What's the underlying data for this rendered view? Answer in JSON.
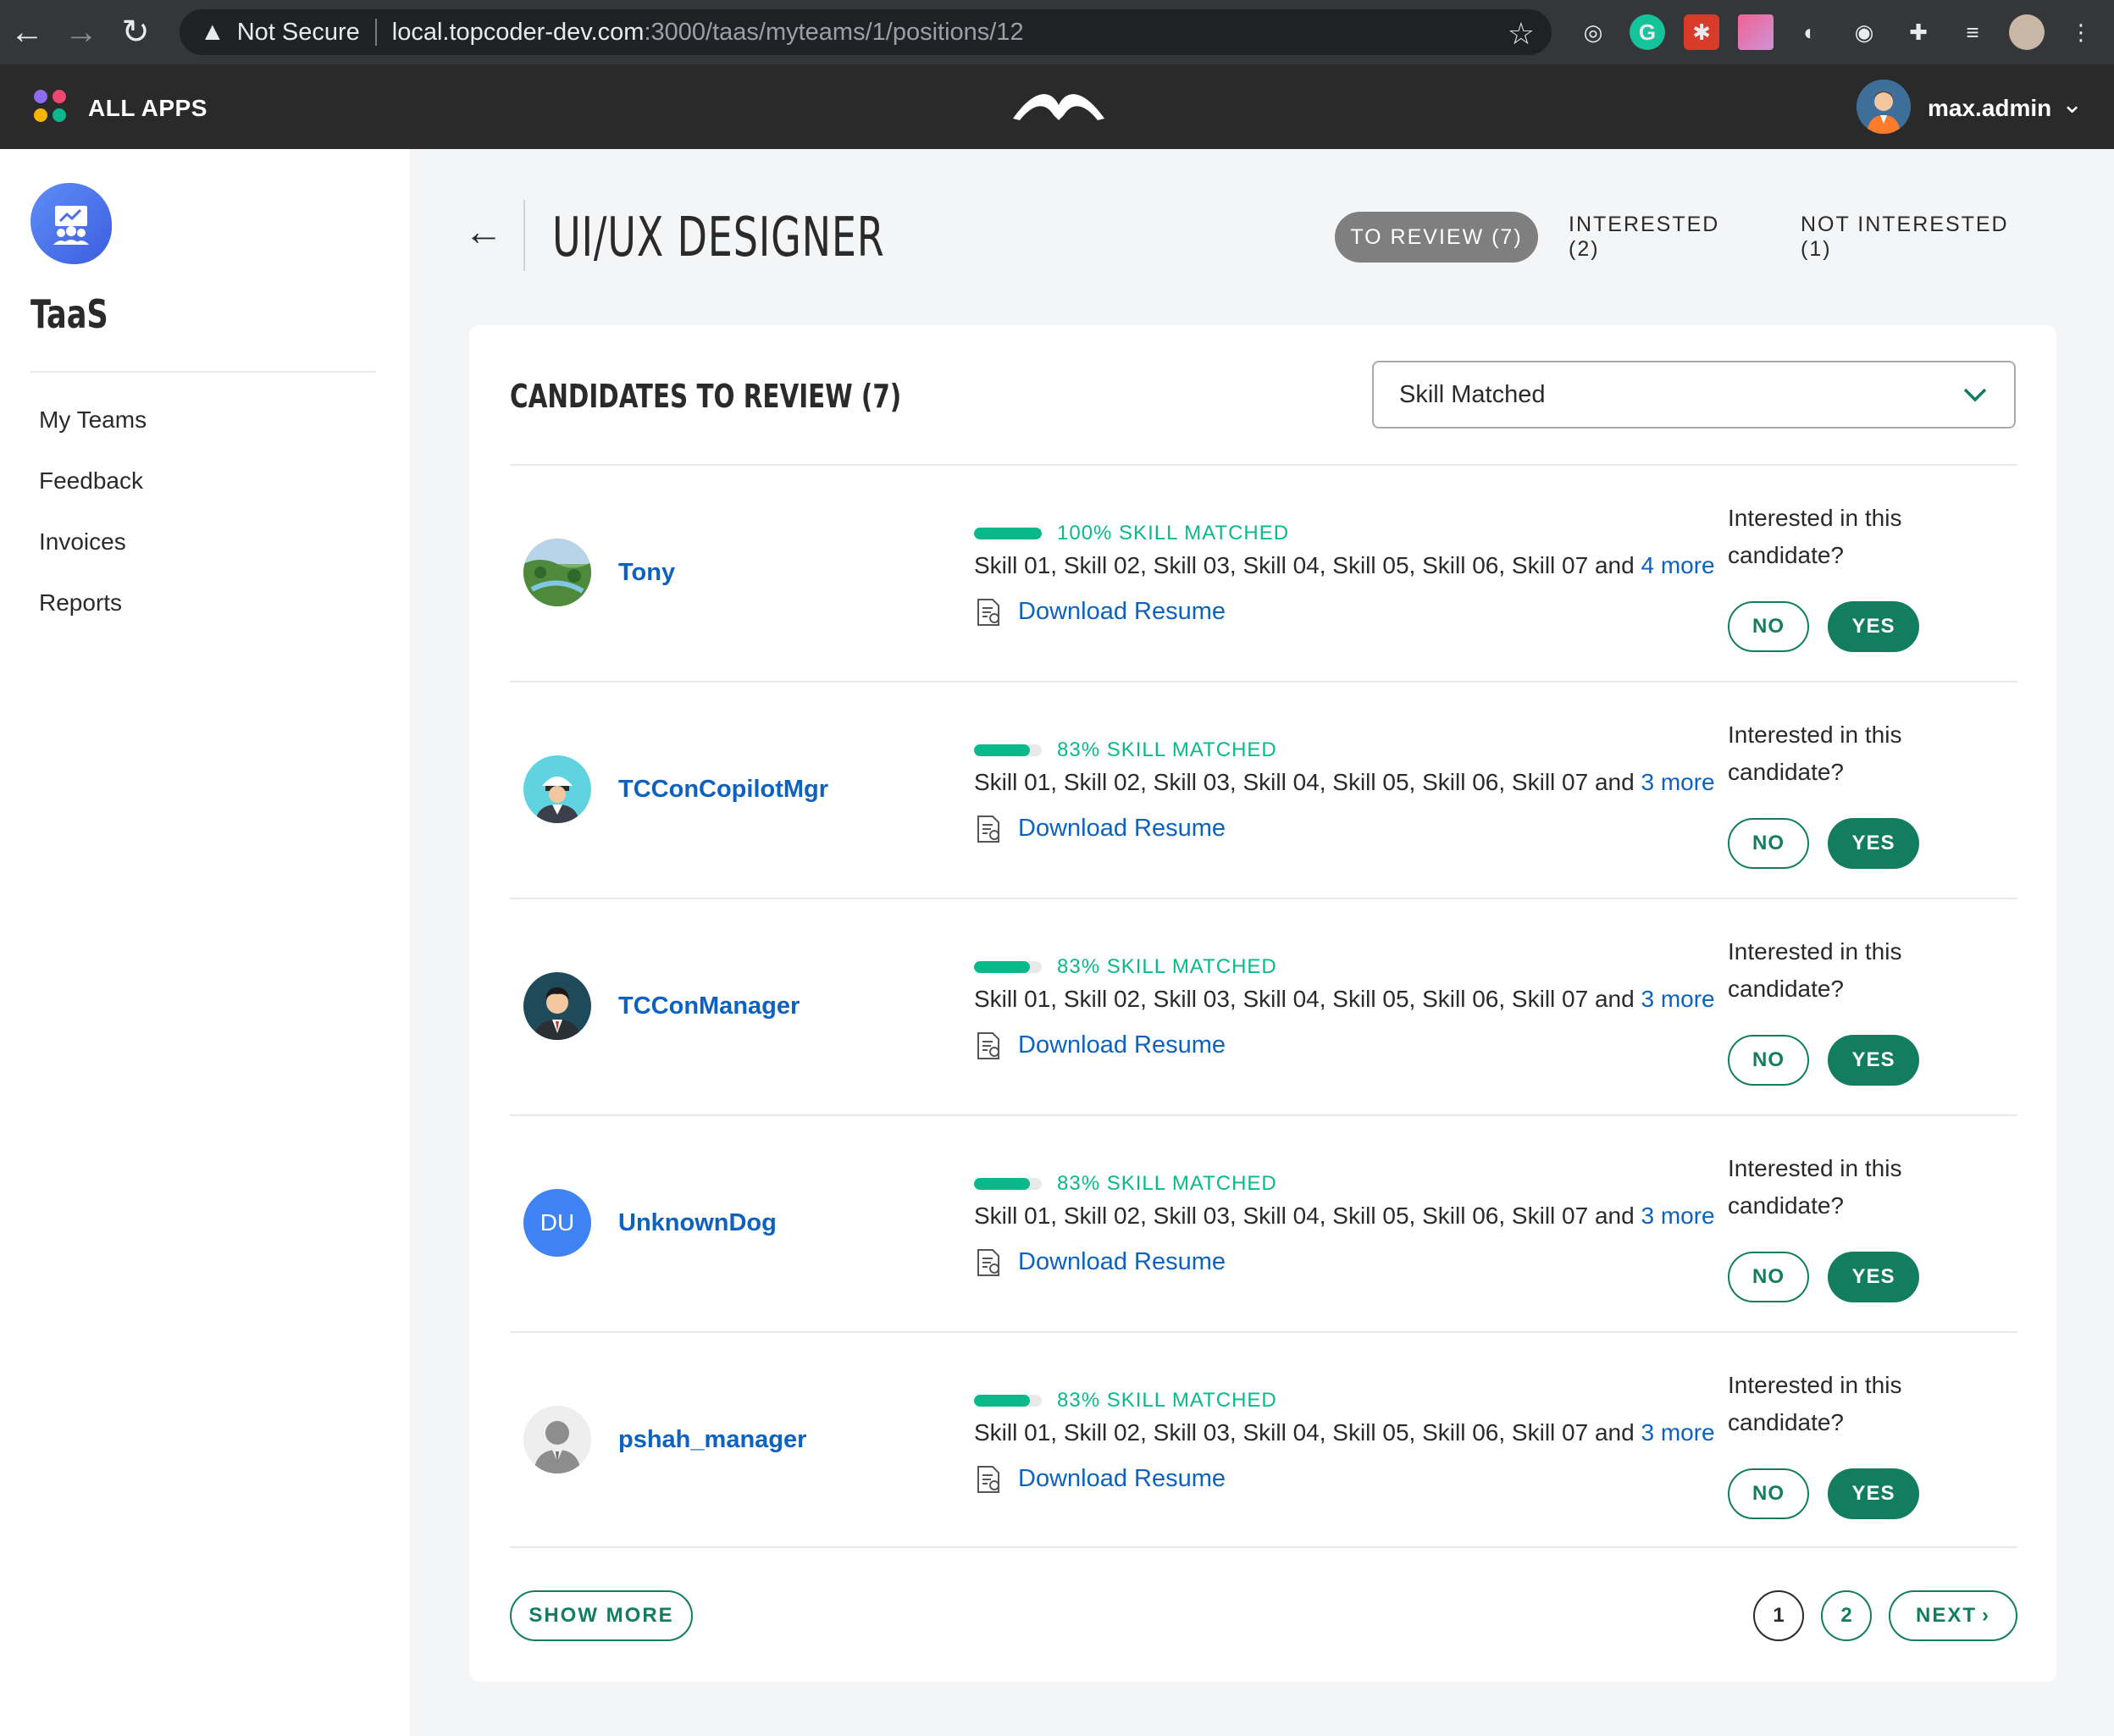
{
  "browser": {
    "security_label": "Not Secure",
    "url_host": "local.topcoder-dev.com",
    "url_path": ":3000/taas/myteams/1/positions/12"
  },
  "appbar": {
    "apps_label": "ALL APPS",
    "user_name": "max.admin"
  },
  "sidebar": {
    "app_title": "TaaS",
    "items": [
      {
        "label": "My Teams"
      },
      {
        "label": "Feedback"
      },
      {
        "label": "Invoices"
      },
      {
        "label": "Reports"
      }
    ]
  },
  "header": {
    "title": "UI/UX DESIGNER",
    "tabs": [
      {
        "label": "TO REVIEW (7)",
        "active": true
      },
      {
        "label": "INTERESTED (2)",
        "active": false
      },
      {
        "label": "NOT INTERESTED (1)",
        "active": false
      }
    ]
  },
  "card": {
    "title": "CANDIDATES TO REVIEW (7)",
    "sort": {
      "value": "Skill Matched"
    },
    "candidates": [
      {
        "name": "Tony",
        "avatar": "landscape-photo",
        "match_percent": 100,
        "match_label": "100% SKILL MATCHED",
        "skills": "Skill 01, Skill 02, Skill 03, Skill 04, Skill 05, Skill 06, Skill 07 and ",
        "more": "4 more"
      },
      {
        "name": "TCConCopilotMgr",
        "avatar": "pilot-photo",
        "match_percent": 83,
        "match_label": "83% SKILL MATCHED",
        "skills": "Skill 01, Skill 02, Skill 03, Skill 04, Skill 05, Skill 06, Skill 07 and ",
        "more": "3 more"
      },
      {
        "name": "TCConManager",
        "avatar": "manager-photo",
        "match_percent": 83,
        "match_label": "83% SKILL MATCHED",
        "skills": "Skill 01, Skill 02, Skill 03, Skill 04, Skill 05, Skill 06, Skill 07 and ",
        "more": "3 more"
      },
      {
        "name": "UnknownDog",
        "avatar": "initials",
        "initials": "DU",
        "match_percent": 83,
        "match_label": "83% SKILL MATCHED",
        "skills": "Skill 01, Skill 02, Skill 03, Skill 04, Skill 05, Skill 06, Skill 07 and ",
        "more": "3 more"
      },
      {
        "name": "pshah_manager",
        "avatar": "silhouette-photo",
        "match_percent": 83,
        "match_label": "83% SKILL MATCHED",
        "skills": "Skill 01, Skill 02, Skill 03, Skill 04, Skill 05, Skill 06, Skill 07 and ",
        "more": "3 more"
      }
    ],
    "resume_label": "Download Resume",
    "interest_question": "Interested in this candidate?",
    "no_label": "NO",
    "yes_label": "YES"
  },
  "pagination": {
    "show_more_label": "SHOW MORE",
    "pages": [
      "1",
      "2"
    ],
    "current_page": "1",
    "next_label": "NEXT"
  },
  "colors": {
    "accent_green": "#137d60",
    "skill_green": "#0ab88a",
    "link_blue": "#0d61bf",
    "topbar": "#2a2a2a"
  }
}
